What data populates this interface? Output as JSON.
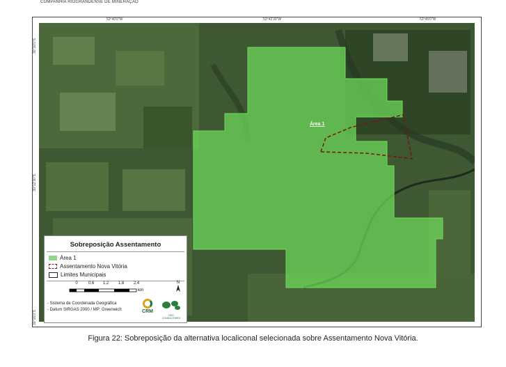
{
  "header": {
    "company": "COMPANHIA RIOGRANDENSE DE MINERAÇÃO"
  },
  "map": {
    "coords_top": [
      "53°40'0\"W",
      "53°42'30\"W",
      "53°45'0\"W"
    ],
    "coords_left": [
      "30°10'0\"S",
      "30°12'30\"S",
      "30°15'0\"S"
    ],
    "area_label": "Área 1",
    "colors": {
      "area_fill": "#6fdc5a",
      "assentamento_line": "#7a1414",
      "base_dark": "#2f4a2a"
    }
  },
  "legend": {
    "title": "Sobreposição Assentamento",
    "items": [
      {
        "label": "Área 1",
        "symbol": "area-swatch"
      },
      {
        "label": "Assentamento Nova Vitória",
        "symbol": "dashed-outline"
      },
      {
        "label": "Limites Municipais",
        "symbol": "outline"
      }
    ],
    "scale_ticks": [
      "0",
      "0,6",
      "1,2",
      "1,8",
      "2,4"
    ],
    "scale_unit": "km",
    "north": "N",
    "reference_lines": [
      "- Sistema de Coordenada Geográfica",
      "- Datum SIRGAS 2000 / MP: Greenwich"
    ],
    "logo_crm": "CRM",
    "logo_geo": "GEO CONSULTORES"
  },
  "caption": "Figura 22: Sobreposição da alternativa localiconal selecionada sobre Assentamento Nova Vitória."
}
